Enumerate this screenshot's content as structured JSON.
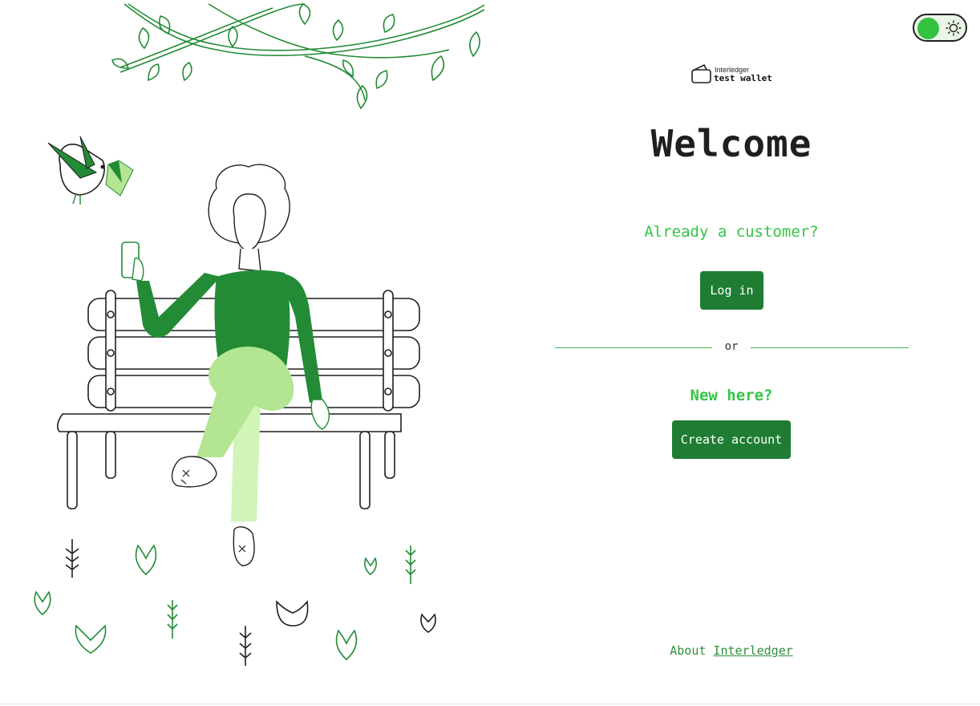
{
  "header": {
    "logo_line1": "Interledger",
    "logo_line2": "test wallet"
  },
  "main": {
    "title": "Welcome",
    "already_customer": "Already a customer?",
    "login_label": "Log in",
    "divider_text": "or",
    "new_here": "New here?",
    "create_account_label": "Create account"
  },
  "footer": {
    "about_prefix": "About",
    "about_link": "Interledger"
  },
  "theme_toggle": {
    "state": "light",
    "icon": "sun-icon"
  },
  "colors": {
    "primary_button": "#1f7d33",
    "accent_text": "#35c445",
    "illustration_green": "#238b36",
    "light_green": "#b3e592"
  }
}
